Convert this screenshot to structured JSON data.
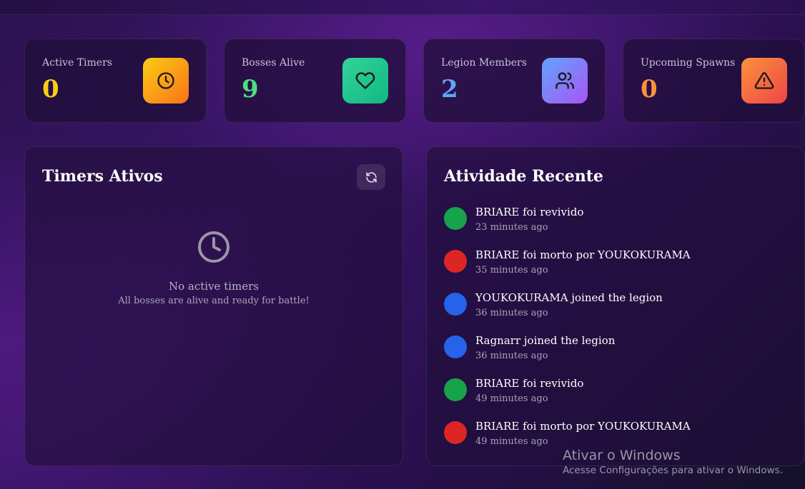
{
  "stats": [
    {
      "label": "Active Timers",
      "value": "0",
      "value_color": "#facc15",
      "icon": "clock-icon",
      "icon_gradient": [
        "#facc15",
        "#f97316"
      ]
    },
    {
      "label": "Bosses Alive",
      "value": "9",
      "value_color": "#4ade80",
      "icon": "heart-icon",
      "icon_gradient": [
        "#34d399",
        "#10b981"
      ]
    },
    {
      "label": "Legion Members",
      "value": "2",
      "value_color": "#60a5fa",
      "icon": "users-icon",
      "icon_gradient": [
        "#60a5fa",
        "#a855f7"
      ]
    },
    {
      "label": "Upcoming Spawns",
      "value": "0",
      "value_color": "#fb923c",
      "icon": "alert-triangle-icon",
      "icon_gradient": [
        "#fb923c",
        "#ef4444"
      ]
    }
  ],
  "timers_panel": {
    "title": "Timers Ativos",
    "refresh_icon": "refresh-icon",
    "empty_title": "No active timers",
    "empty_subtitle": "All bosses are alive and ready for battle!"
  },
  "activity_panel": {
    "title": "Atividade Recente",
    "items": [
      {
        "text": "BRIARE foi revivido",
        "time": "23 minutes ago",
        "color": "#16a34a"
      },
      {
        "text": "BRIARE foi morto por YOUKOKURAMA",
        "time": "35 minutes ago",
        "color": "#dc2626"
      },
      {
        "text": "YOUKOKURAMA joined the legion",
        "time": "36 minutes ago",
        "color": "#2563eb"
      },
      {
        "text": "Ragnarr joined the legion",
        "time": "36 minutes ago",
        "color": "#2563eb"
      },
      {
        "text": "BRIARE foi revivido",
        "time": "49 minutes ago",
        "color": "#16a34a"
      },
      {
        "text": "BRIARE foi morto por YOUKOKURAMA",
        "time": "49 minutes ago",
        "color": "#dc2626"
      }
    ]
  },
  "watermark": {
    "title": "Ativar o Windows",
    "subtitle": "Acesse Configurações para ativar o Windows."
  }
}
